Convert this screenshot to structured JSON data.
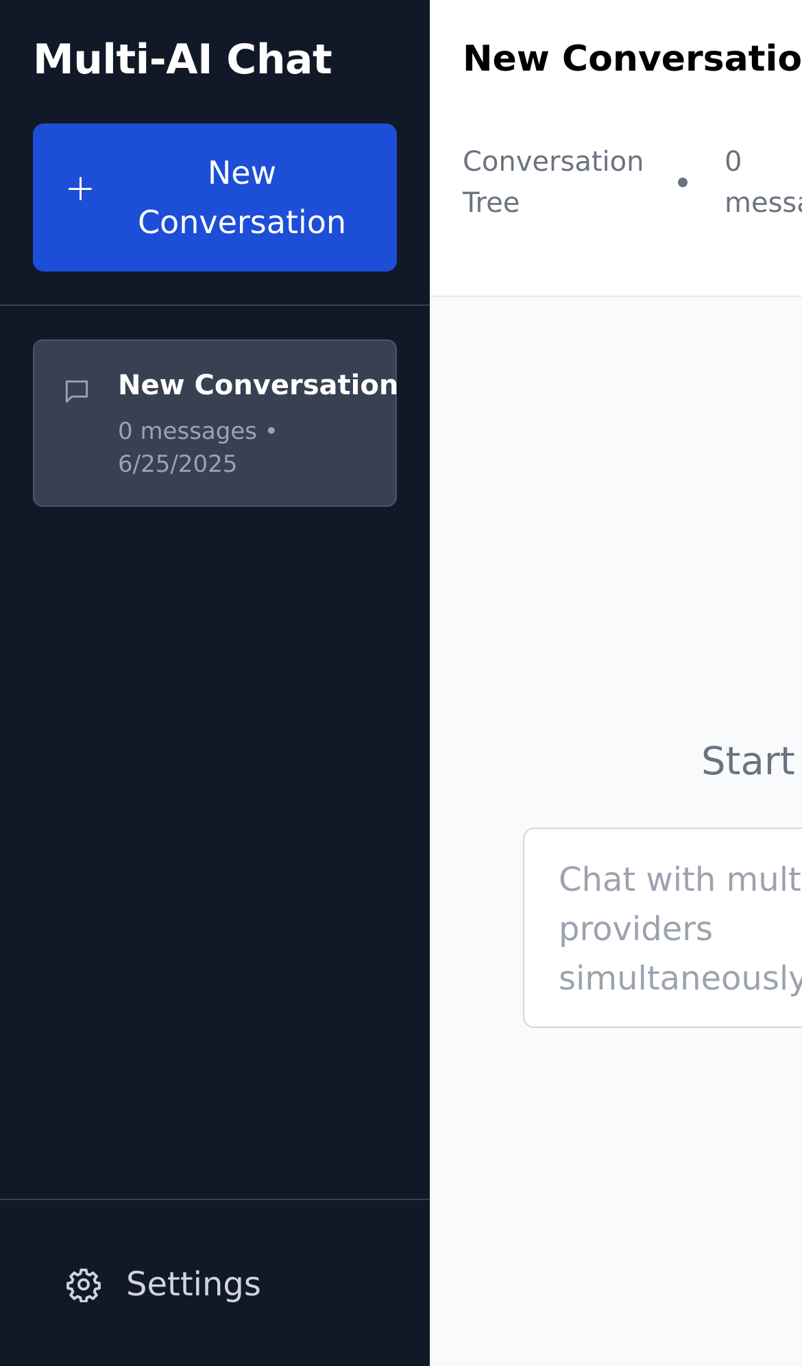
{
  "sidebar": {
    "app_title": "Multi-AI Chat",
    "new_conversation_button": "New Conversation",
    "conversations": [
      {
        "title": "New Conversation",
        "meta": "0 messages • 6/25/2025",
        "icon": "chat-bubble-icon"
      }
    ],
    "settings_label": "Settings",
    "settings_icon": "gear-icon"
  },
  "main": {
    "title": "New Conversation",
    "subtitle_left": "Conversation Tree",
    "subtitle_right": "0\nmessa",
    "empty_heading": "Start",
    "empty_description": "Chat with mult providers simultaneously"
  },
  "colors": {
    "sidebar_bg": "#111827",
    "accent": "#1d4ed8",
    "conv_item_bg": "#374151",
    "main_bg": "#f9fafb",
    "muted_text": "#6b7280"
  }
}
